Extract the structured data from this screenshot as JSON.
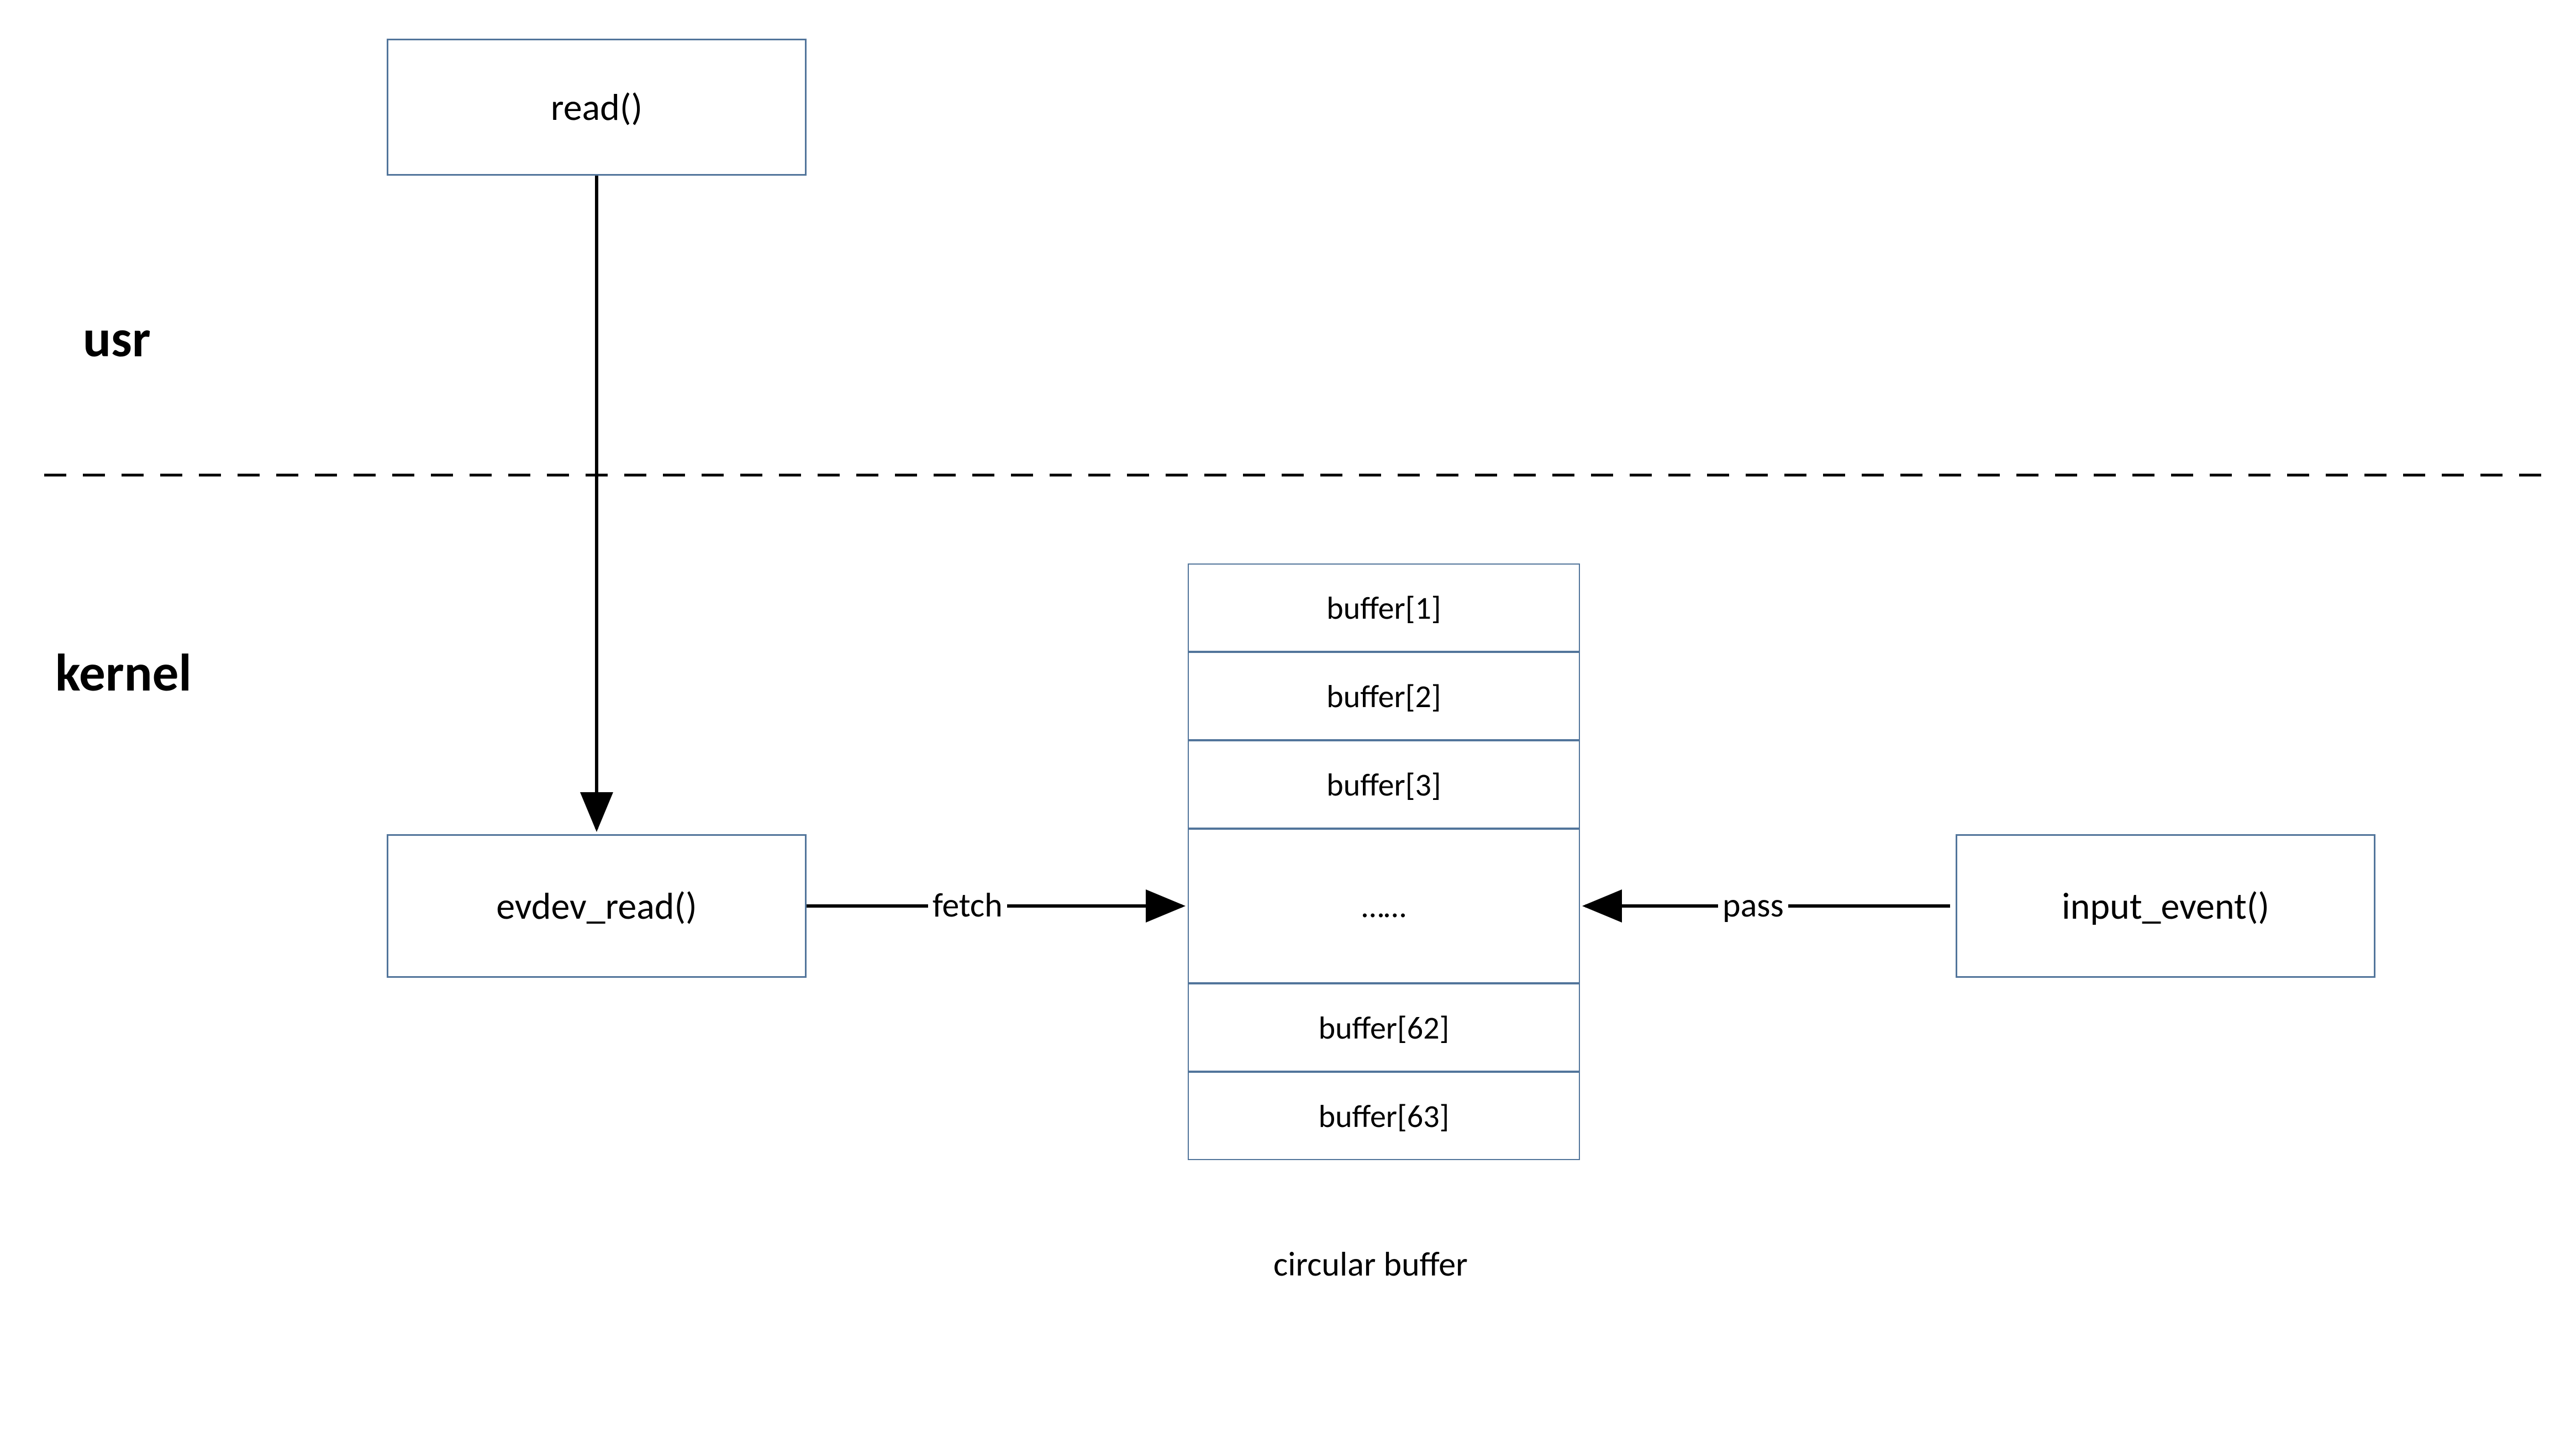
{
  "sections": {
    "usr": "usr",
    "kernel": "kernel"
  },
  "nodes": {
    "read": "read()",
    "evdev_read": "evdev_read()",
    "input_event": "input_event()"
  },
  "buffer": {
    "cells": [
      "buffer[1]",
      "buffer[2]",
      "buffer[3]",
      "……",
      "buffer[62]",
      "buffer[63]"
    ],
    "caption": "circular buffer"
  },
  "edges": {
    "fetch": "fetch",
    "pass": "pass"
  }
}
